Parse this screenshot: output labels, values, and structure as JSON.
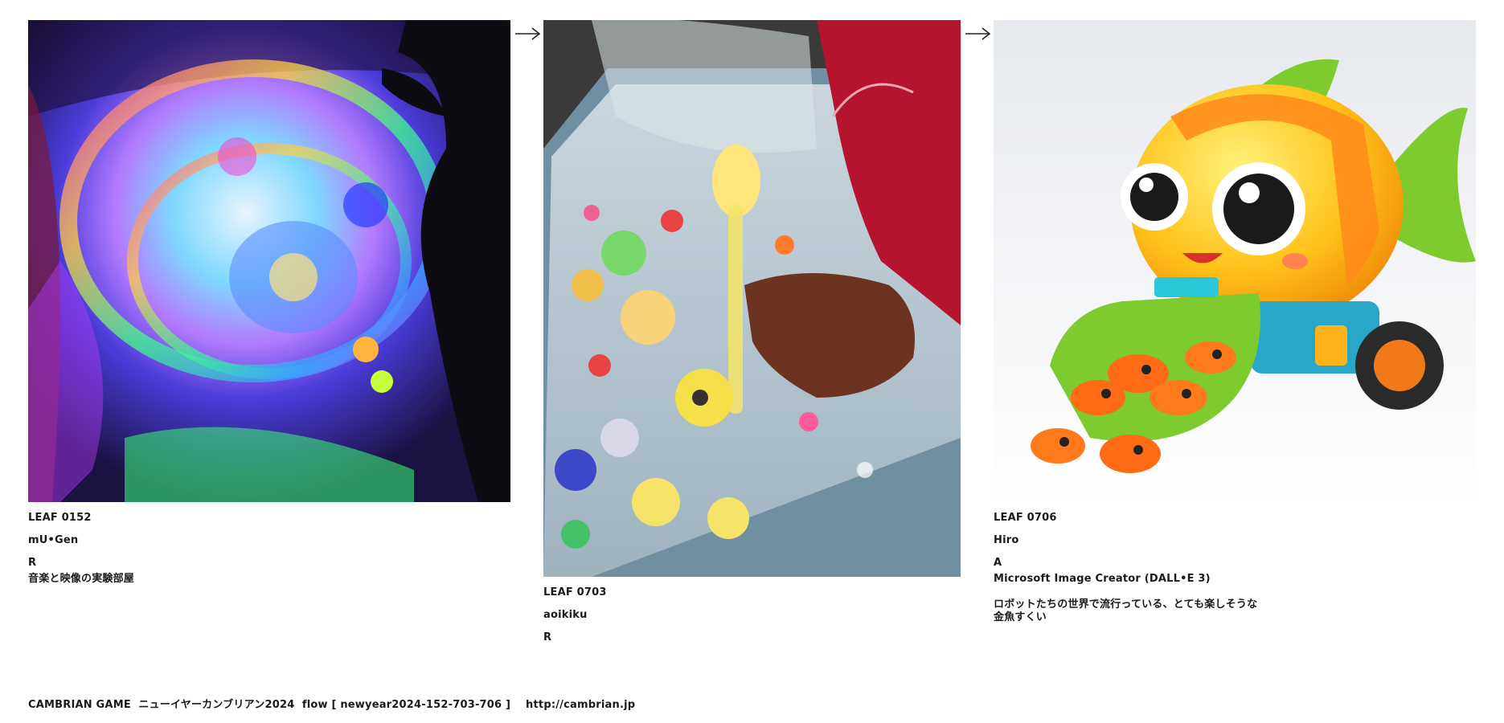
{
  "leaves": [
    {
      "id": "LEAF 0152",
      "author": "mU•Gen",
      "type": "R",
      "text": "音楽と映像の実験部屋"
    },
    {
      "id": "LEAF 0703",
      "author": "aoikiku",
      "type": "R"
    },
    {
      "id": "LEAF 0706",
      "author": "Hiro",
      "type": "A",
      "text": "Microsoft Image Creator (DALL•E 3)",
      "description_line1": "ロボットたちの世界で流行っている、とても楽しそうな",
      "description_line2": "金魚すくい"
    }
  ],
  "footer": {
    "text": "CAMBRIAN GAME  ニューイヤーカンブリアン2024  flow [ newyear2024-152-703-706 ]    http://cambrian.jp"
  },
  "icons": {
    "arrow": "right-arrow-icon"
  }
}
